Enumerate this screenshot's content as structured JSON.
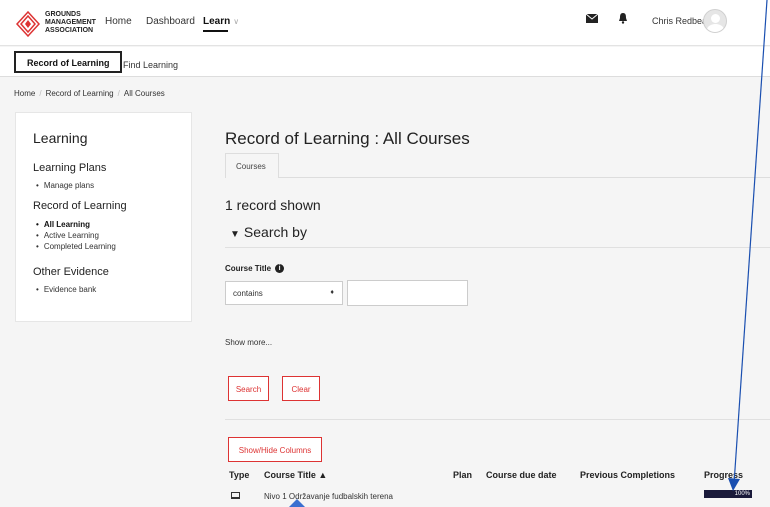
{
  "brand": {
    "logo_text": [
      "GROUNDS",
      "MANAGEMENT",
      "ASSOCIATION"
    ],
    "accent": "#d33333"
  },
  "topnav": {
    "links": [
      {
        "label": "Home"
      },
      {
        "label": "Dashboard"
      }
    ],
    "learn_label": "Learn",
    "user_name": "Chris Redbear"
  },
  "subnav": {
    "active_tab": "Record of Learning",
    "other_tab": "Find Learning"
  },
  "breadcrumb": [
    "Home",
    "Record of Learning",
    "All Courses"
  ],
  "sidebar": {
    "title": "Learning",
    "sections": [
      {
        "heading": "Learning Plans",
        "items": [
          {
            "label": "Manage plans"
          }
        ]
      },
      {
        "heading": "Record of Learning",
        "items": [
          {
            "label": "All Learning",
            "active": true
          },
          {
            "label": "Active Learning"
          },
          {
            "label": "Completed Learning"
          }
        ]
      },
      {
        "heading": "Other Evidence",
        "items": [
          {
            "label": "Evidence bank"
          }
        ]
      }
    ]
  },
  "main": {
    "title": "Record of Learning : All Courses",
    "tab": "Courses",
    "record_count": "1 record shown",
    "search_heading": "Search by",
    "field_label": "Course Title",
    "operator_value": "contains",
    "search_value": "",
    "show_more": "Show more...",
    "search_button": "Search",
    "clear_button": "Clear",
    "columns_button": "Show/Hide Columns"
  },
  "table": {
    "headers": [
      "Type",
      "Course Title ▲",
      "Plan",
      "Course due date",
      "Previous Completions",
      "Progress"
    ],
    "rows": [
      {
        "type_icon": "course-icon",
        "title": "Nivo 1 Održavanje fudbalskih terena",
        "progress": 100,
        "progress_label": "100%"
      }
    ]
  }
}
